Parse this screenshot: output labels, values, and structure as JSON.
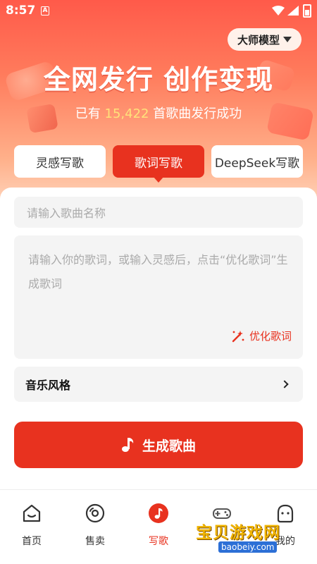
{
  "status_bar": {
    "time": "8:57",
    "notification_letter": "A"
  },
  "header": {
    "mode_button": "大师模型"
  },
  "hero": {
    "title": "全网发行 创作变现",
    "subtitle_prefix": "已有 ",
    "song_count": "15,422",
    "subtitle_suffix": " 首歌曲发行成功"
  },
  "tabs": [
    {
      "label": "灵感写歌",
      "active": false
    },
    {
      "label": "歌词写歌",
      "active": true
    },
    {
      "label": "DeepSeek写歌",
      "active": false
    }
  ],
  "form": {
    "song_name_placeholder": "请输入歌曲名称",
    "lyrics_placeholder": "请输入你的歌词，或输入灵感后，点击“优化歌词”生成歌词",
    "optimize_label": "优化歌词",
    "music_style_label": "音乐风格",
    "generate_label": "生成歌曲"
  },
  "bottom_nav": [
    {
      "label": "首页",
      "icon": "home-icon"
    },
    {
      "label": "售卖",
      "icon": "disc-icon"
    },
    {
      "label": "写歌",
      "icon": "music-note-icon",
      "active": true
    },
    {
      "label": "",
      "icon": "gamepad-icon"
    },
    {
      "label": "我的",
      "icon": "profile-icon"
    }
  ],
  "watermark": {
    "text": "宝贝游戏网",
    "url": "baobeiy.com"
  },
  "colors": {
    "accent": "#e8321f",
    "highlight": "#ffe27a"
  }
}
